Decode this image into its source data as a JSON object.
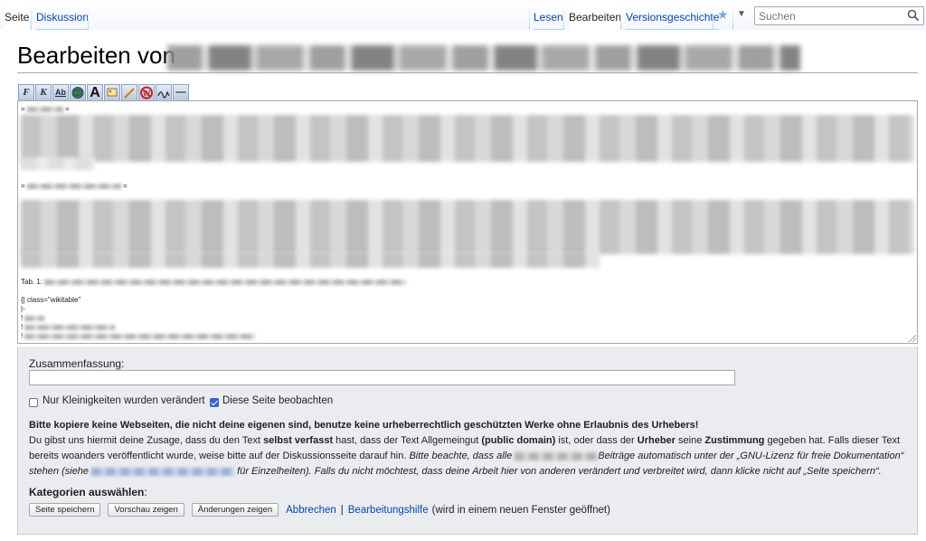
{
  "tabs": {
    "left": [
      {
        "label": "Seite",
        "selected": true
      },
      {
        "label": "Diskussion",
        "selected": false
      }
    ],
    "right": [
      {
        "label": "Lesen",
        "selected": false
      },
      {
        "label": "Bearbeiten",
        "selected": true
      },
      {
        "label": "Versionsgeschichte",
        "selected": false
      }
    ],
    "watch_icon": "star-icon",
    "more_icon": "chevron-down-icon"
  },
  "search": {
    "placeholder": "Suchen",
    "icon": "search-icon"
  },
  "page": {
    "title_prefix": "Bearbeiten von"
  },
  "toolbar": {
    "buttons": [
      {
        "label": "F",
        "icon": "bold-icon"
      },
      {
        "label": "K",
        "icon": "italic-icon"
      },
      {
        "label": "Ab",
        "icon": "internal-link-icon"
      },
      {
        "label": "",
        "icon": "external-link-icon"
      },
      {
        "label": "A",
        "icon": "heading-icon"
      },
      {
        "label": "",
        "icon": "image-icon"
      },
      {
        "label": "",
        "icon": "media-icon"
      },
      {
        "label": "W",
        "icon": "nowiki-icon"
      },
      {
        "label": "",
        "icon": "signature-icon"
      },
      {
        "label": "—",
        "icon": "horizontal-line-icon"
      }
    ]
  },
  "editor": {
    "line_intro": "= ",
    "line_intro_end": " =",
    "line_section2": "= ",
    "line_section2_end": " =",
    "table_caption_prefix": "Tab. 1:",
    "table_start": "{| class=\"wikitable\"",
    "table_row": "|-",
    "table_header_1": "!",
    "table_header_2": "!",
    "table_header_3": "!"
  },
  "options": {
    "summary_label": "Zusammenfassung:",
    "summary_value": "",
    "minor_label": "Nur Kleinigkeiten wurden verändert",
    "minor_checked": false,
    "watch_label": "Diese Seite beobachten",
    "watch_checked": true,
    "warning": "Bitte kopiere keine Webseiten, die nicht deine eigenen sind, benutze keine urheberrechtlich geschützten Werke ohne Erlaubnis des Urhebers!",
    "license_1": "Du gibst uns hiermit deine Zusage, dass du den Text ",
    "license_bold_1": "selbst verfasst",
    "license_2": " hast, dass der Text Allgemeingut ",
    "license_bold_2": "(public domain)",
    "license_3": " ist, oder dass der ",
    "license_bold_3": "Urheber",
    "license_4": " seine ",
    "license_bold_4": "Zustimmung",
    "license_5": " gegeben hat. Falls dieser Text bereits woanders veröffentlicht wurde, weise bitte auf der Diskussionsseite darauf hin. ",
    "license_italic_1": "Bitte beachte, dass alle ",
    "license_italic_2": "Beiträge automatisch unter der „GNU-Lizenz für freie Dokumentation“ stehen (siehe ",
    "license_italic_3": " für Einzelheiten). Falls du nicht möchtest, dass deine Arbeit hier von anderen verändert und verbreitet wird, dann klicke nicht auf „Seite speichern“.",
    "categories_label": "Kategorien auswählen",
    "categories_colon": ":",
    "save_label": "Seite speichern",
    "preview_label": "Vorschau zeigen",
    "diff_label": "Änderungen zeigen",
    "cancel_label": "Abbrechen",
    "separator": "|",
    "help_label": "Bearbeitungshilfe",
    "help_note": "(wird in einem neuen Fenster geöffnet)"
  }
}
